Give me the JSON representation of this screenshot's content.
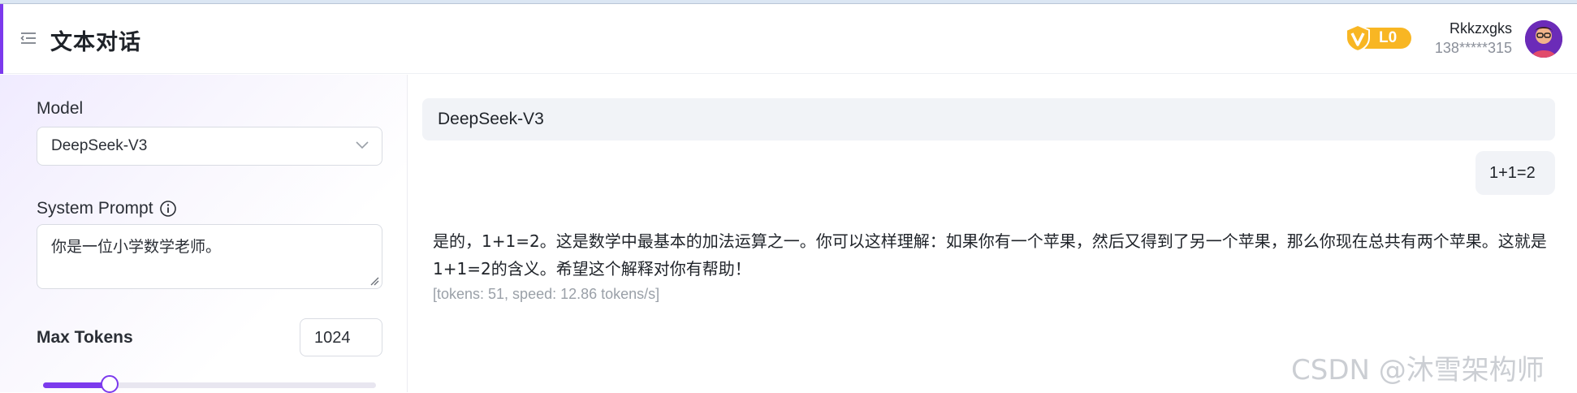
{
  "header": {
    "title": "文本对话",
    "vip_level": "L0",
    "user_name": "Rkkzxgks",
    "user_phone": "138*****315"
  },
  "sidebar": {
    "model_label": "Model",
    "model_value": "DeepSeek-V3",
    "system_prompt_label": "System Prompt",
    "system_prompt_value": "你是一位小学数学老师。",
    "max_tokens_label": "Max Tokens",
    "max_tokens_value": "1024",
    "max_tokens_slider_fraction": 0.2
  },
  "chat": {
    "model_name": "DeepSeek-V3",
    "user_message": "1+1=2",
    "assistant_message": "是的，1+1=2。这是数学中最基本的加法运算之一。你可以这样理解：如果你有一个苹果，然后又得到了另一个苹果，那么你现在总共有两个苹果。这就是1+1=2的含义。希望这个解释对你有帮助！",
    "stats": "[tokens: 51, speed: 12.86 tokens/s]"
  },
  "watermark": "CSDN @沐雪架构师",
  "colors": {
    "accent": "#7c3aed",
    "vip_gold": "#f8b623",
    "bubble_bg": "#f1f3f7"
  },
  "icons": {
    "menu": "menu-collapse-icon",
    "info": "info-icon",
    "chevron": "chevron-down-icon",
    "vip": "vip-shield-icon",
    "avatar": "user-avatar"
  }
}
